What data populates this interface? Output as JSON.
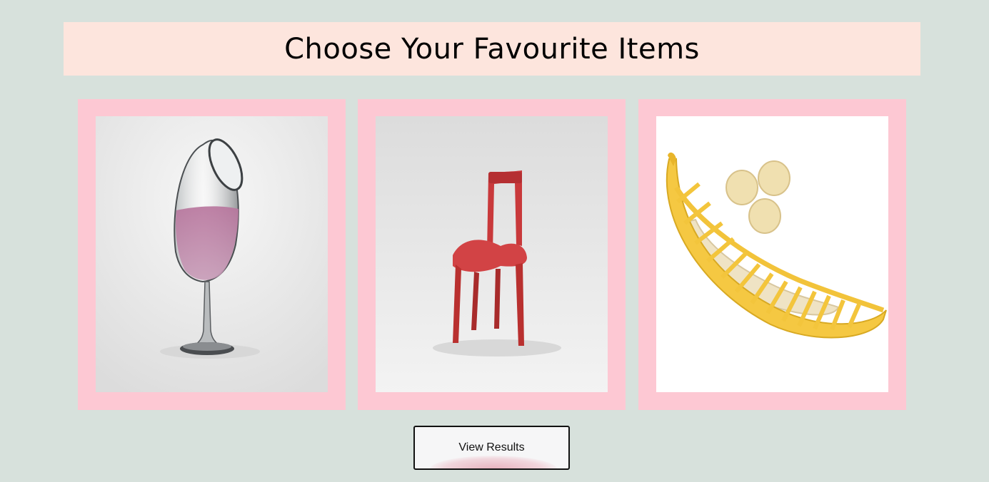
{
  "header": {
    "title": "Choose Your Favourite Items"
  },
  "cards": [
    {
      "subject": "wine glass with pink liquid",
      "icon": "wine-glass-image"
    },
    {
      "subject": "red chair",
      "icon": "red-chair-image"
    },
    {
      "subject": "banana slicer with banana slices",
      "icon": "banana-slicer-image"
    }
  ],
  "actions": {
    "view_results_label": "View Results"
  },
  "colors": {
    "background": "#d7e1dc",
    "header_bg": "#fde5dd",
    "card_bg": "#fdc8d3",
    "button_bg": "#f6f6f7"
  }
}
